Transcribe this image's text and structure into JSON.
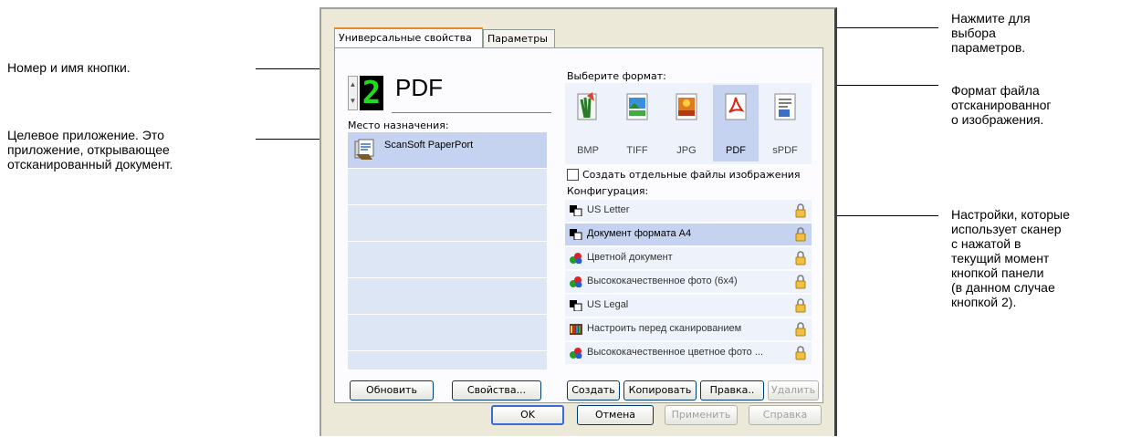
{
  "callouts": {
    "button_number_name": "Номер и имя кнопки.",
    "target_app": "Целевое приложение. Это\nприложение, открывающее\nотсканированный документ.",
    "click_options": "Нажмите для\nвыбора\nпараметров.",
    "file_format": "Формат файла\nотсканированног\nо изображения.",
    "settings": "Настройки, которые\nиспользует сканер\nс нажатой в\nтекущий момент\nкнопкой панели\n(в данном случае\nкнопкой 2)."
  },
  "tabs": [
    "Универсальные свойства",
    "Параметры"
  ],
  "button": {
    "number": "2",
    "name": "PDF"
  },
  "destination": {
    "label": "Место назначения:",
    "apps": [
      "ScanSoft PaperPort"
    ]
  },
  "format": {
    "label": "Выберите формат:",
    "options": [
      "BMP",
      "TIFF",
      "JPG",
      "PDF",
      "sPDF"
    ],
    "selected": "PDF"
  },
  "separate_files_checkbox": {
    "label": "Создать отдельные файлы изображения",
    "checked": false
  },
  "configuration": {
    "label": "Конфигурация:",
    "items": [
      {
        "label": "US Letter",
        "icon": "bw-icon"
      },
      {
        "label": "Документ формата A4",
        "icon": "bw-icon",
        "selected": true
      },
      {
        "label": "Цветной документ",
        "icon": "color-icon"
      },
      {
        "label": "Высококачественное фото (6x4)",
        "icon": "color-icon"
      },
      {
        "label": "US Legal",
        "icon": "bw-icon"
      },
      {
        "label": "Настроить перед сканированием",
        "icon": "configure-icon"
      },
      {
        "label": "Высококачественное цветное фото ...",
        "icon": "color-icon"
      }
    ]
  },
  "buttons": {
    "refresh": "Обновить",
    "properties": "Свойства...",
    "create": "Создать",
    "copy": "Копировать",
    "edit": "Правка..",
    "delete": "Удалить",
    "ok": "OK",
    "cancel": "Отмена",
    "apply": "Применить",
    "help": "Справка"
  }
}
